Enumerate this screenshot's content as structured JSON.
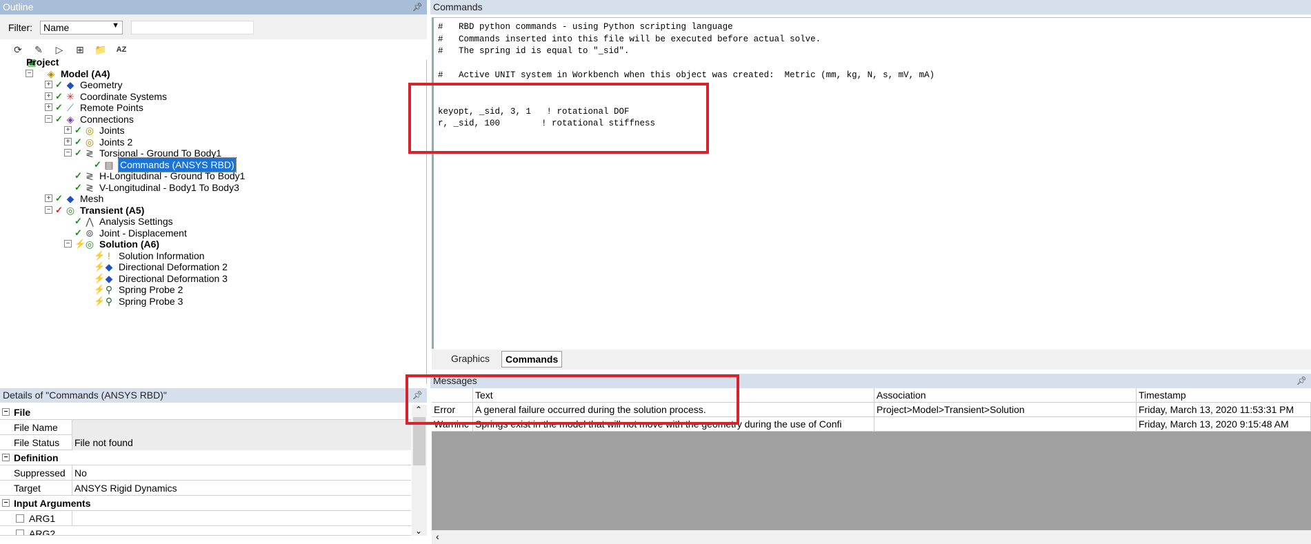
{
  "outline": {
    "title": "Outline",
    "filter_label": "Filter:",
    "filter_value": "Name",
    "search_value": "",
    "tree": [
      {
        "label": "Project",
        "bold": true
      },
      {
        "label": "Model (A4)",
        "bold": true
      },
      {
        "label": "Geometry"
      },
      {
        "label": "Coordinate Systems"
      },
      {
        "label": "Remote Points"
      },
      {
        "label": "Connections"
      },
      {
        "label": "Joints"
      },
      {
        "label": "Joints 2"
      },
      {
        "label": "Torsional - Ground To Body1"
      },
      {
        "label": "Commands (ANSYS RBD)"
      },
      {
        "label": "H-Longitudinal - Ground To Body1"
      },
      {
        "label": "V-Longitudinal - Body1 To  Body3"
      },
      {
        "label": "Mesh"
      },
      {
        "label": "Transient (A5)",
        "bold": true
      },
      {
        "label": "Analysis Settings"
      },
      {
        "label": "Joint - Displacement"
      },
      {
        "label": "Solution (A6)",
        "bold": true
      },
      {
        "label": "Solution Information"
      },
      {
        "label": "Directional Deformation 2"
      },
      {
        "label": "Directional Deformation 3"
      },
      {
        "label": "Spring Probe 2"
      },
      {
        "label": "Spring Probe 3"
      }
    ]
  },
  "details": {
    "title": "Details of \"Commands (ANSYS RBD)\"",
    "cat_file": "File",
    "file_name_key": "File Name",
    "file_name_val": "",
    "file_status_key": "File Status",
    "file_status_val": "File not found",
    "cat_def": "Definition",
    "suppressed_key": "Suppressed",
    "suppressed_val": "No",
    "target_key": "Target",
    "target_val": "ANSYS Rigid Dynamics",
    "cat_input": "Input Arguments",
    "arg1": "ARG1",
    "arg2": "ARG2"
  },
  "commands": {
    "title": "Commands",
    "lines": [
      "#   RBD python commands - using Python scripting language",
      "#   Commands inserted into this file will be executed before actual solve.",
      "#   The spring id is equal to \"_sid\".",
      "",
      "#   Active UNIT system in Workbench when this object was created:  Metric (mm, kg, N, s, mV, mA)",
      "",
      "",
      "keyopt, _sid, 3, 1   ! rotational DOF",
      "r, _sid, 100        ! rotational stiffness"
    ],
    "tab_graphics": "Graphics",
    "tab_commands": "Commands"
  },
  "messages": {
    "title": "Messages",
    "headers": [
      "Text",
      "Association",
      "Timestamp"
    ],
    "rows": [
      {
        "type": "Error",
        "text": "A general failure occurred during the solution process.",
        "assoc": "Project>Model>Transient>Solution",
        "time": "Friday, March 13, 2020 11:53:31 PM"
      },
      {
        "type": "Warninc",
        "text": "Springs exist in the model that will not move with the geometry during the use of Confi",
        "assoc": "",
        "time": "Friday, March 13, 2020 9:15:48 AM"
      }
    ]
  },
  "colors": {
    "highlight": "#d8232a",
    "selection": "#1a73d7",
    "title_bar": "#a8bdd7"
  }
}
